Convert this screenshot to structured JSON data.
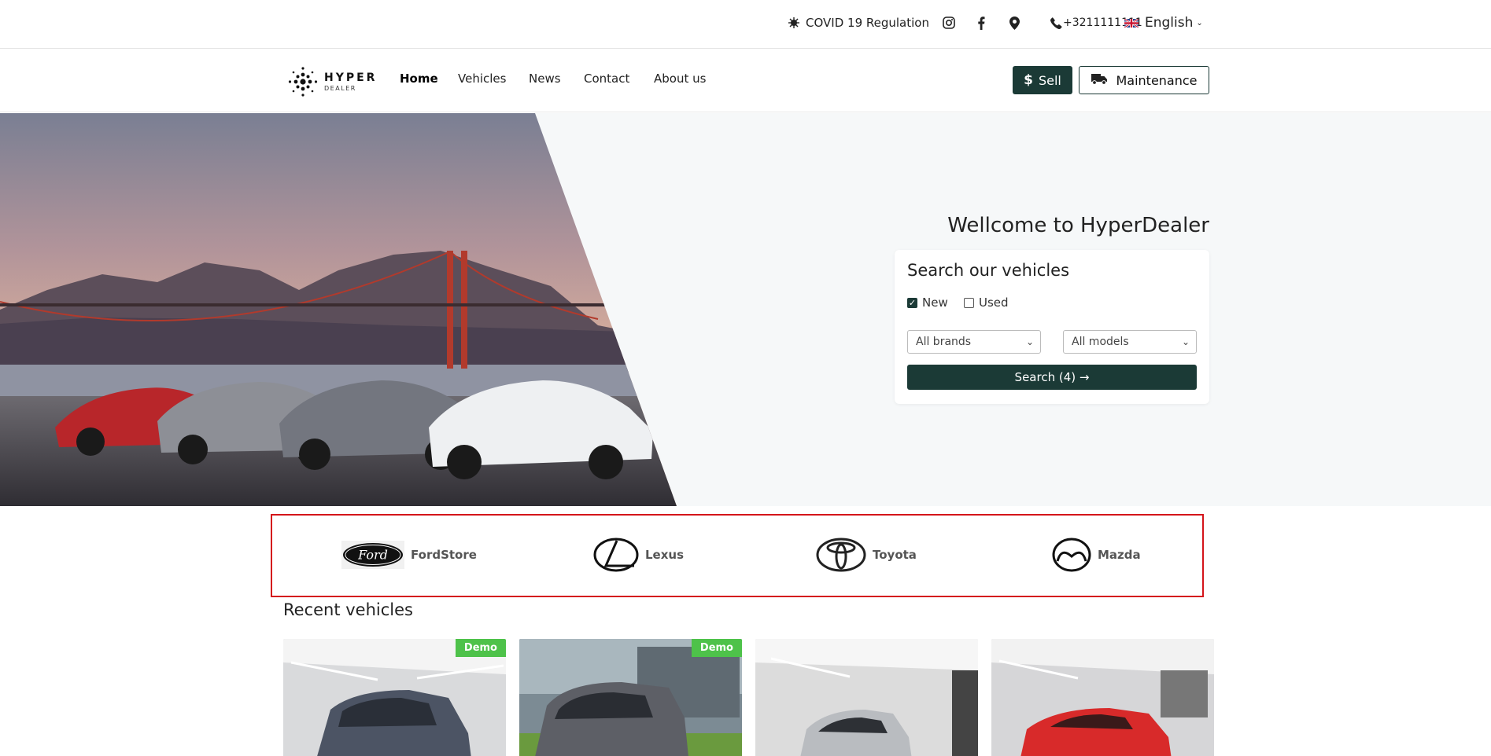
{
  "topbar": {
    "covid": "COVID 19 Regulation",
    "phone": "+3211111111",
    "language": "English"
  },
  "brand_logo": {
    "line1": "HYPER",
    "line2": "DEALER"
  },
  "nav": {
    "items": [
      "Home",
      "Vehicles",
      "News",
      "Contact",
      "About us"
    ],
    "active": "Home"
  },
  "header_buttons": {
    "sell": "Sell",
    "maintenance": "Maintenance"
  },
  "hero": {
    "welcome": "Wellcome to HyperDealer"
  },
  "search": {
    "title": "Search our vehicles",
    "new_label": "New",
    "used_label": "Used",
    "new_checked": true,
    "used_checked": false,
    "brands_select": "All brands",
    "models_select": "All models",
    "button": "Search (4) →"
  },
  "brands": [
    "FordStore",
    "Lexus",
    "Toyota",
    "Mazda"
  ],
  "ford_logo_text": "Ford",
  "recent": {
    "title": "Recent vehicles",
    "badge": "Demo"
  },
  "colors": {
    "primary": "#1b3a36",
    "badge": "#4ec24a",
    "highlight": "#d4141a"
  }
}
